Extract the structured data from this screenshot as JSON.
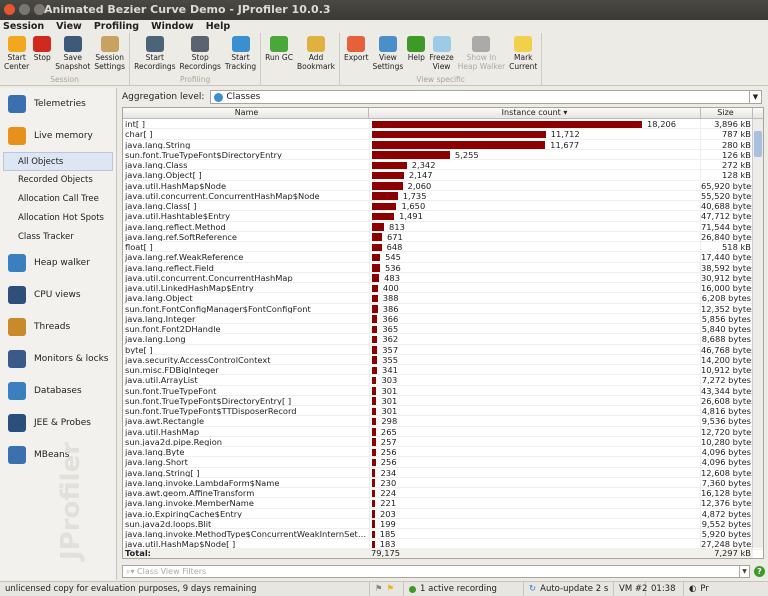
{
  "window": {
    "title": "Animated Bezier Curve Demo - JProfiler 10.0.3"
  },
  "menu": [
    "Session",
    "View",
    "Profiling",
    "Window",
    "Help"
  ],
  "toolbar": {
    "groups": [
      {
        "label": "Session",
        "items": [
          {
            "label": "Start\nCenter",
            "icon": "start-center-icon",
            "color": "#f2a81c"
          },
          {
            "label": "Stop",
            "icon": "stop-icon",
            "color": "#d02a1e"
          },
          {
            "label": "Save\nSnapshot",
            "icon": "save-icon",
            "color": "#3d5a78"
          },
          {
            "label": "Session\nSettings",
            "icon": "session-settings-icon",
            "color": "#c8a260"
          }
        ]
      },
      {
        "label": "Profiling",
        "items": [
          {
            "label": "Start\nRecordings",
            "icon": "start-recordings-icon",
            "color": "#4c6478"
          },
          {
            "label": "Stop\nRecordings",
            "icon": "stop-recordings-icon",
            "color": "#5a6470"
          },
          {
            "label": "Start\nTracking",
            "icon": "start-tracking-icon",
            "color": "#3a8fd0"
          }
        ]
      },
      {
        "label": "",
        "items": [
          {
            "label": "Run GC",
            "icon": "run-gc-icon",
            "color": "#4aa83a"
          },
          {
            "label": "Add\nBookmark",
            "icon": "add-bookmark-icon",
            "color": "#e0b040"
          }
        ]
      },
      {
        "label": "View specific",
        "items": [
          {
            "label": "Export",
            "icon": "export-icon",
            "color": "#e6603a"
          },
          {
            "label": "View\nSettings",
            "icon": "view-settings-icon",
            "color": "#4a8fc8"
          },
          {
            "label": "Help",
            "icon": "help-icon",
            "color": "#3e9a26"
          },
          {
            "label": "Freeze\nView",
            "icon": "freeze-icon",
            "color": "#9ccbe8"
          },
          {
            "label": "Show In\nHeap Walker",
            "icon": "heap-walker-icon",
            "color": "#aaaaaa",
            "disabled": true
          },
          {
            "label": "Mark\nCurrent",
            "icon": "mark-current-icon",
            "color": "#f3d04a"
          }
        ]
      }
    ]
  },
  "sidebar": {
    "items": [
      {
        "label": "Telemetries",
        "icon": "telemetries-icon",
        "color": "#3a6fb0"
      },
      {
        "label": "Live memory",
        "icon": "live-memory-icon",
        "color": "#e8901c",
        "subitems": [
          {
            "label": "All Objects",
            "selected": true
          },
          {
            "label": "Recorded Objects"
          },
          {
            "label": "Allocation Call Tree"
          },
          {
            "label": "Allocation Hot Spots"
          },
          {
            "label": "Class Tracker"
          }
        ]
      },
      {
        "label": "Heap walker",
        "icon": "heap-walker-icon",
        "color": "#3a7fc0"
      },
      {
        "label": "CPU views",
        "icon": "cpu-icon",
        "color": "#2d4f7a"
      },
      {
        "label": "Threads",
        "icon": "threads-icon",
        "color": "#c88a2a"
      },
      {
        "label": "Monitors & locks",
        "icon": "lock-icon",
        "color": "#3a5a8a"
      },
      {
        "label": "Databases",
        "icon": "database-icon",
        "color": "#3a7fc0"
      },
      {
        "label": "JEE & Probes",
        "icon": "probe-icon",
        "color": "#2a4f7a"
      },
      {
        "label": "MBeans",
        "icon": "mbeans-icon",
        "color": "#3a6fb0"
      }
    ],
    "watermark": "JProfiler"
  },
  "aggregation": {
    "label": "Aggregation level:",
    "value": "Classes"
  },
  "table": {
    "columns": [
      "Name",
      "Instance count ▾",
      "Size"
    ],
    "bar_color": "#8b0000",
    "rows": [
      [
        "int[ ]",
        18206,
        "3,896 kB"
      ],
      [
        "char[ ]",
        11712,
        "787 kB"
      ],
      [
        "java.lang.String",
        11677,
        "280 kB"
      ],
      [
        "sun.font.TrueTypeFont$DirectoryEntry",
        5255,
        "126 kB"
      ],
      [
        "java.lang.Class",
        2342,
        "272 kB"
      ],
      [
        "java.lang.Object[ ]",
        2147,
        "128 kB"
      ],
      [
        "java.util.HashMap$Node",
        2060,
        "65,920 bytes"
      ],
      [
        "java.util.concurrent.ConcurrentHashMap$Node",
        1735,
        "55,520 bytes"
      ],
      [
        "java.lang.Class[ ]",
        1650,
        "40,688 bytes"
      ],
      [
        "java.util.Hashtable$Entry",
        1491,
        "47,712 bytes"
      ],
      [
        "java.lang.reflect.Method",
        813,
        "71,544 bytes"
      ],
      [
        "java.lang.ref.SoftReference",
        671,
        "26,840 bytes"
      ],
      [
        "float[ ]",
        648,
        "518 kB"
      ],
      [
        "java.lang.ref.WeakReference",
        545,
        "17,440 bytes"
      ],
      [
        "java.lang.reflect.Field",
        536,
        "38,592 bytes"
      ],
      [
        "java.util.concurrent.ConcurrentHashMap",
        483,
        "30,912 bytes"
      ],
      [
        "java.util.LinkedHashMap$Entry",
        400,
        "16,000 bytes"
      ],
      [
        "java.lang.Object",
        388,
        "6,208 bytes"
      ],
      [
        "sun.font.FontConfigManager$FontConfigFont",
        386,
        "12,352 bytes"
      ],
      [
        "java.lang.Integer",
        366,
        "5,856 bytes"
      ],
      [
        "sun.font.Font2DHandle",
        365,
        "5,840 bytes"
      ],
      [
        "java.lang.Long",
        362,
        "8,688 bytes"
      ],
      [
        "byte[ ]",
        357,
        "46,768 bytes"
      ],
      [
        "java.security.AccessControlContext",
        355,
        "14,200 bytes"
      ],
      [
        "sun.misc.FDBigInteger",
        341,
        "10,912 bytes"
      ],
      [
        "java.util.ArrayList",
        303,
        "7,272 bytes"
      ],
      [
        "sun.font.TrueTypeFont",
        301,
        "43,344 bytes"
      ],
      [
        "sun.font.TrueTypeFont$DirectoryEntry[ ]",
        301,
        "26,608 bytes"
      ],
      [
        "sun.font.TrueTypeFont$TTDisposerRecord",
        301,
        "4,816 bytes"
      ],
      [
        "java.awt.Rectangle",
        298,
        "9,536 bytes"
      ],
      [
        "java.util.HashMap",
        265,
        "12,720 bytes"
      ],
      [
        "sun.java2d.pipe.Region",
        257,
        "10,280 bytes"
      ],
      [
        "java.lang.Byte",
        256,
        "4,096 bytes"
      ],
      [
        "java.lang.Short",
        256,
        "4,096 bytes"
      ],
      [
        "java.lang.String[ ]",
        234,
        "12,608 bytes"
      ],
      [
        "java.lang.invoke.LambdaForm$Name",
        230,
        "7,360 bytes"
      ],
      [
        "java.awt.geom.AffineTransform",
        224,
        "16,128 bytes"
      ],
      [
        "java.lang.invoke.MemberName",
        221,
        "12,376 bytes"
      ],
      [
        "java.io.ExpiringCache$Entry",
        203,
        "4,872 bytes"
      ],
      [
        "sun.java2d.loops.Blit",
        199,
        "9,552 bytes"
      ],
      [
        "java.lang.invoke.MethodType$ConcurrentWeakInternSet$...",
        185,
        "5,920 bytes"
      ],
      [
        "java.util.HashMap$Node[ ]",
        183,
        "27,248 bytes"
      ]
    ],
    "total": {
      "label": "Total:",
      "count": "79,175",
      "size": "7,297 kB"
    }
  },
  "filter": {
    "placeholder": "Class View Filters"
  },
  "status": {
    "license": "unlicensed copy for evaluation purposes, 9 days remaining",
    "recording": "1 active recording",
    "autoupdate": "Auto-update 2 s",
    "vm": "VM #2",
    "time": "01:38",
    "extra": "Pr"
  }
}
